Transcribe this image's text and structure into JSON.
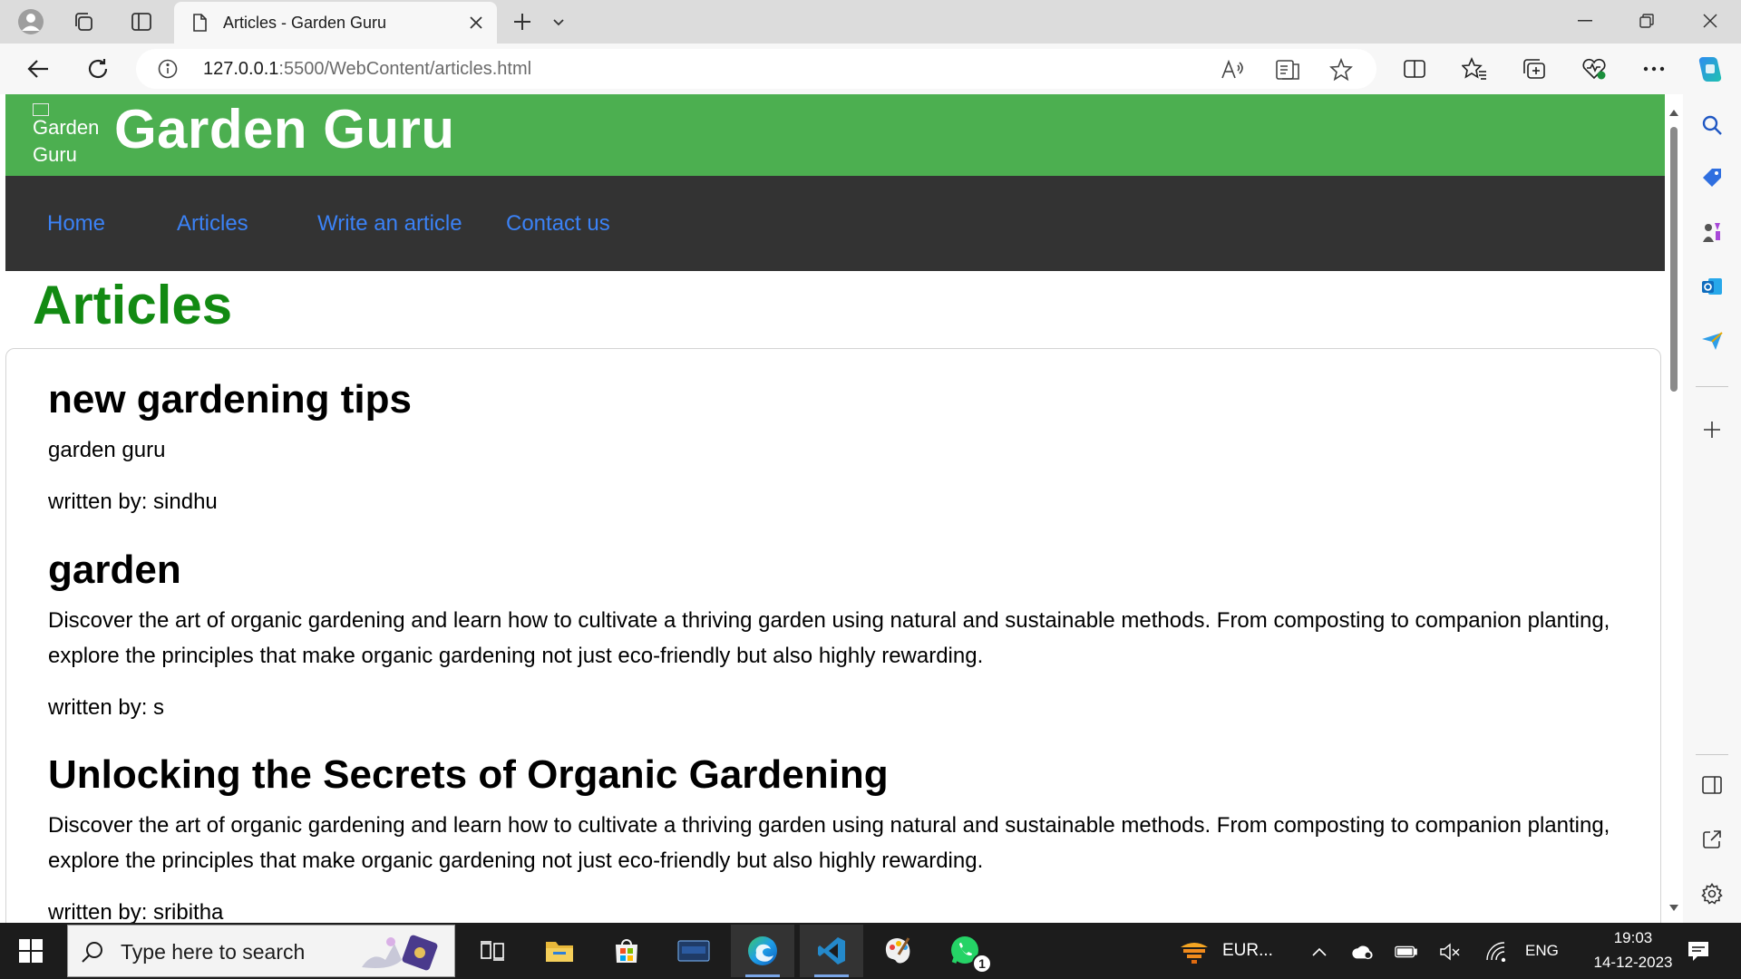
{
  "browser": {
    "tab_title": "Articles - Garden Guru",
    "url_host": "127.0.0.1",
    "url_path": ":5500/WebContent/articles.html"
  },
  "site": {
    "logo_alt": "Garden Guru",
    "title": "Garden Guru",
    "nav": [
      "Home",
      "Articles",
      "Write an article",
      "Contact us"
    ],
    "page_heading": "Articles",
    "articles": [
      {
        "title": "new gardening tips",
        "body": "garden guru",
        "author": "written by: sindhu"
      },
      {
        "title": "garden",
        "body": "Discover the art of organic gardening and learn how to cultivate a thriving garden using natural and sustainable methods. From composting to companion planting, explore the principles that make organic gardening not just eco-friendly but also highly rewarding.",
        "author": "written by: s"
      },
      {
        "title": "Unlocking the Secrets of Organic Gardening",
        "body": "Discover the art of organic gardening and learn how to cultivate a thriving garden using natural and sustainable methods. From composting to companion planting, explore the principles that make organic gardening not just eco-friendly but also highly rewarding.",
        "author": "written by: sribitha"
      }
    ]
  },
  "taskbar": {
    "search_placeholder": "Type here to search",
    "weather_text": "EUR...",
    "language": "ENG",
    "time": "19:03",
    "date": "14-12-2023",
    "whatsapp_badge": "1"
  },
  "colors": {
    "header_green": "#4caf50",
    "nav_dark": "#333333",
    "nav_link_blue": "#3b82f6",
    "heading_green": "#128a12"
  }
}
